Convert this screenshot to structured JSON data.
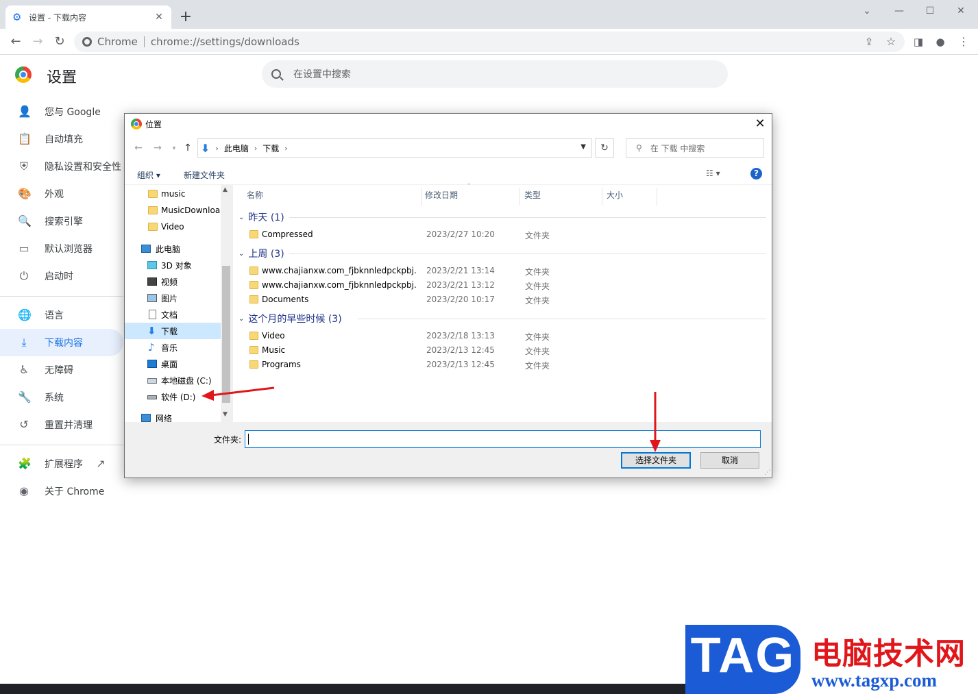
{
  "browser": {
    "tab_title": "设置 - 下载内容",
    "omnibox_scheme": "Chrome",
    "omnibox_url": "chrome://settings/downloads"
  },
  "settings": {
    "title": "设置",
    "search_placeholder": "在设置中搜索",
    "sidebar": [
      {
        "label": "您与 Google",
        "icon": "person-icon"
      },
      {
        "label": "自动填充",
        "icon": "clipboard-icon"
      },
      {
        "label": "隐私设置和安全性",
        "icon": "shield-icon"
      },
      {
        "label": "外观",
        "icon": "palette-icon"
      },
      {
        "label": "搜索引擎",
        "icon": "search-icon"
      },
      {
        "label": "默认浏览器",
        "icon": "browser-icon"
      },
      {
        "label": "启动时",
        "icon": "power-icon"
      },
      {
        "label": "语言",
        "icon": "globe-icon"
      },
      {
        "label": "下载内容",
        "icon": "download-icon",
        "active": true
      },
      {
        "label": "无障碍",
        "icon": "accessibility-icon"
      },
      {
        "label": "系统",
        "icon": "wrench-icon"
      },
      {
        "label": "重置并清理",
        "icon": "restore-icon"
      },
      {
        "label": "扩展程序",
        "icon": "extension-icon"
      },
      {
        "label": "关于 Chrome",
        "icon": "chrome-icon"
      }
    ]
  },
  "dialog": {
    "title": "位置",
    "breadcrumb": [
      "此电脑",
      "下载"
    ],
    "search_placeholder": "在 下载 中搜索",
    "organize_label": "组织 ▾",
    "new_folder_label": "新建文件夹",
    "nav_items": [
      {
        "label": "music",
        "icon": "folder-icon"
      },
      {
        "label": "MusicDownloa",
        "icon": "folder-icon"
      },
      {
        "label": "Video",
        "icon": "folder-icon"
      },
      {
        "label": "此电脑",
        "icon": "computer-icon"
      },
      {
        "label": "3D 对象",
        "icon": "3d-objects-icon"
      },
      {
        "label": "视频",
        "icon": "video-icon"
      },
      {
        "label": "图片",
        "icon": "pictures-icon"
      },
      {
        "label": "文档",
        "icon": "documents-icon"
      },
      {
        "label": "下载",
        "icon": "download-icon",
        "selected": true
      },
      {
        "label": "音乐",
        "icon": "music-icon"
      },
      {
        "label": "桌面",
        "icon": "desktop-icon"
      },
      {
        "label": "本地磁盘 (C:)",
        "icon": "drive-icon"
      },
      {
        "label": "软件 (D:)",
        "icon": "drive-icon"
      },
      {
        "label": "网络",
        "icon": "network-icon"
      }
    ],
    "columns": [
      "名称",
      "修改日期",
      "类型",
      "大小"
    ],
    "groups": [
      {
        "label": "昨天 (1)",
        "rows": [
          {
            "name": "Compressed",
            "date": "2023/2/27 10:20",
            "type": "文件夹"
          }
        ]
      },
      {
        "label": "上周 (3)",
        "rows": [
          {
            "name": "www.chajianxw.com_fjbknnledpckpbj...",
            "date": "2023/2/21 13:14",
            "type": "文件夹"
          },
          {
            "name": "www.chajianxw.com_fjbknnledpckpbj...",
            "date": "2023/2/21 13:12",
            "type": "文件夹"
          },
          {
            "name": "Documents",
            "date": "2023/2/20 10:17",
            "type": "文件夹"
          }
        ]
      },
      {
        "label": "这个月的早些时候 (3)",
        "rows": [
          {
            "name": "Video",
            "date": "2023/2/18 13:13",
            "type": "文件夹"
          },
          {
            "name": "Music",
            "date": "2023/2/13 12:45",
            "type": "文件夹"
          },
          {
            "name": "Programs",
            "date": "2023/2/13 12:45",
            "type": "文件夹"
          }
        ]
      }
    ],
    "folder_label": "文件夹:",
    "folder_value": "",
    "select_button": "选择文件夹",
    "cancel_button": "取消"
  },
  "watermark": {
    "badge": "TAG",
    "site_name": "电脑技术网",
    "url": "www.tagxp.com"
  },
  "colors": {
    "accent": "#1a73e8",
    "active_bg": "#e8f0fe",
    "annotation_arrow": "#e0161b"
  }
}
